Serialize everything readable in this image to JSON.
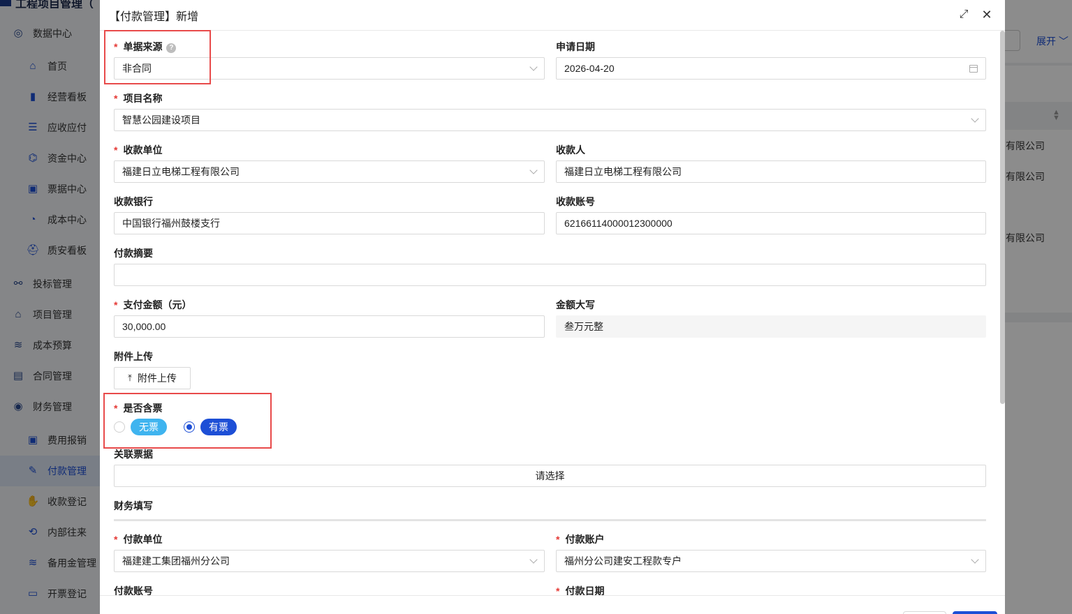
{
  "app": {
    "title": "工程项目管理（",
    "nav": [
      {
        "label": "数据中心",
        "icon": "compass-icon",
        "glyph": "◎",
        "level": 1
      },
      {
        "label": "首页",
        "icon": "home-icon",
        "glyph": "⌂",
        "level": 2
      },
      {
        "label": "经营看板",
        "icon": "bar-chart-icon",
        "glyph": "▮",
        "level": 2
      },
      {
        "label": "应收应付",
        "icon": "ledger-icon",
        "glyph": "☰",
        "level": 2
      },
      {
        "label": "资金中心",
        "icon": "bank-icon",
        "glyph": "⌬",
        "level": 2
      },
      {
        "label": "票据中心",
        "icon": "ticket-icon",
        "glyph": "▣",
        "level": 2
      },
      {
        "label": "成本中心",
        "icon": "pie-chart-icon",
        "glyph": "◔",
        "level": 2
      },
      {
        "label": "质安看板",
        "icon": "helmet-icon",
        "glyph": "⛑",
        "level": 2
      },
      {
        "label": "投标管理",
        "icon": "network-icon",
        "glyph": "⚯",
        "level": 1
      },
      {
        "label": "项目管理",
        "icon": "building-icon",
        "glyph": "⌂",
        "level": 1
      },
      {
        "label": "成本预算",
        "icon": "layers-icon",
        "glyph": "≋",
        "level": 1
      },
      {
        "label": "合同管理",
        "icon": "briefcase-icon",
        "glyph": "▤",
        "level": 1
      },
      {
        "label": "财务管理",
        "icon": "coins-icon",
        "glyph": "◉",
        "level": 1
      },
      {
        "label": "费用报销",
        "icon": "money-icon",
        "glyph": "▣",
        "level": 2
      },
      {
        "label": "付款管理",
        "icon": "edit-icon",
        "glyph": "✎",
        "level": 2,
        "active": true
      },
      {
        "label": "收款登记",
        "icon": "hand-money-icon",
        "glyph": "✋",
        "level": 2
      },
      {
        "label": "内部往来",
        "icon": "sync-icon",
        "glyph": "⟲",
        "level": 2
      },
      {
        "label": "备用金管理",
        "icon": "stack-icon",
        "glyph": "≋",
        "level": 2
      },
      {
        "label": "开票登记",
        "icon": "invoice-icon",
        "glyph": "▭",
        "level": 2
      }
    ],
    "right_panel": {
      "expand_label": "展开",
      "rows": [
        "有限公司",
        "有限公司",
        "有限公司"
      ]
    }
  },
  "modal": {
    "title": "【付款管理】新增",
    "fields": {
      "doc_source": {
        "label": "单据来源",
        "value": "非合同"
      },
      "apply_date": {
        "label": "申请日期",
        "value": "2026-04-20"
      },
      "project_name": {
        "label": "项目名称",
        "value": "智慧公园建设项目"
      },
      "payee_unit": {
        "label": "收款单位",
        "value": "福建日立电梯工程有限公司"
      },
      "payee": {
        "label": "收款人",
        "value": "福建日立电梯工程有限公司"
      },
      "payee_bank": {
        "label": "收款银行",
        "value": "中国银行福州鼓楼支行"
      },
      "payee_account": {
        "label": "收款账号",
        "value": "62166114000012300000"
      },
      "summary": {
        "label": "付款摘要",
        "value": ""
      },
      "amount": {
        "label": "支付金额（元）",
        "value": "30,000.00"
      },
      "amount_words": {
        "label": "金额大写",
        "value": "叁万元整"
      },
      "attachment": {
        "label": "附件上传",
        "button": "附件上传"
      },
      "has_invoice": {
        "label": "是否含票",
        "options": [
          "无票",
          "有票"
        ],
        "selected": "有票",
        "colors": {
          "no": "#3fb4ef",
          "yes": "#1d4fd6"
        }
      },
      "related_invoice": {
        "label": "关联票据",
        "value": "请选择"
      }
    },
    "finance_section": {
      "label": "财务填写"
    },
    "finance_fields": {
      "pay_unit": {
        "label": "付款单位",
        "value": "福建建工集团福州分公司"
      },
      "pay_account_name": {
        "label": "付款账户",
        "value": "福州分公司建安工程款专户"
      },
      "pay_account_no": {
        "label": "付款账号"
      },
      "pay_date": {
        "label": "付款日期"
      }
    }
  }
}
